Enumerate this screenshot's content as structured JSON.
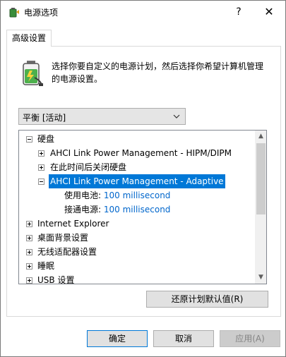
{
  "window": {
    "title": "电源选项",
    "help_glyph": "?",
    "close_glyph": "✕"
  },
  "tabs": [
    {
      "label": "高级设置",
      "selected": true
    }
  ],
  "description": "选择你要自定义的电源计划，然后选择你希望计算机管理的电源设置。",
  "plan_select": {
    "value": "平衡 [活动]"
  },
  "tree": {
    "items": [
      {
        "label": "硬盘",
        "expanded": true
      },
      {
        "label": "AHCI Link Power Management - HIPM/DIPM",
        "expanded": false
      },
      {
        "label": "在此时间后关闭硬盘",
        "expanded": false
      },
      {
        "label": "AHCI Link Power Management - Adaptive",
        "expanded": true,
        "selected": true
      },
      {
        "label": "使用电池:",
        "value": "100 millisecond"
      },
      {
        "label": "接通电源:",
        "value": "100 millisecond"
      },
      {
        "label": "Internet Explorer",
        "expanded": false
      },
      {
        "label": "桌面背景设置",
        "expanded": false
      },
      {
        "label": "无线适配器设置",
        "expanded": false
      },
      {
        "label": "睡眠",
        "expanded": false
      },
      {
        "label": "USB 设置",
        "expanded": false
      }
    ]
  },
  "buttons": {
    "restore": "还原计划默认值(R)",
    "ok": "确定",
    "cancel": "取消",
    "apply": "应用(A)"
  },
  "colors": {
    "accent": "#0078d7",
    "value_text": "#0066cc"
  }
}
